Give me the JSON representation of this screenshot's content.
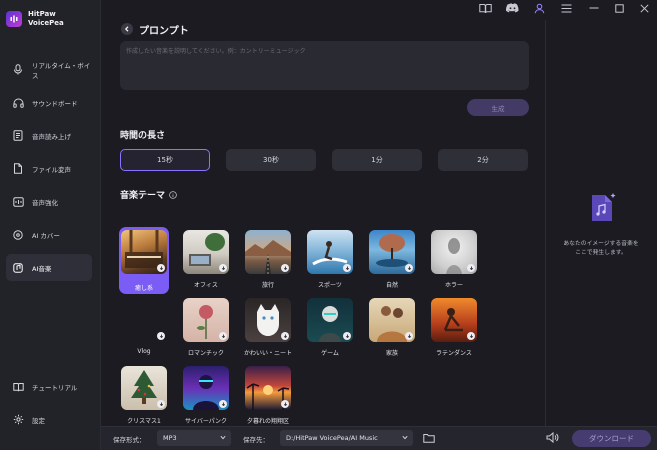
{
  "app": {
    "name_line1": "HitPaw",
    "name_line2": "VoicePea"
  },
  "sidebar": {
    "items": [
      {
        "label": "リアルタイム・ボイス",
        "icon": "microphone-icon"
      },
      {
        "label": "サウンドボード",
        "icon": "headphones-icon"
      },
      {
        "label": "音声読み上げ",
        "icon": "text-to-speech-icon"
      },
      {
        "label": "ファイル変声",
        "icon": "file-icon"
      },
      {
        "label": "音声強化",
        "icon": "enhance-icon"
      },
      {
        "label": "AI カバー",
        "icon": "cover-icon"
      },
      {
        "label": "AI音楽",
        "icon": "music-icon",
        "active": true
      }
    ],
    "bottom": [
      {
        "label": "チュートリアル",
        "icon": "book-icon"
      },
      {
        "label": "設定",
        "icon": "gear-icon"
      }
    ]
  },
  "header": {
    "title": "プロンプト"
  },
  "prompt": {
    "placeholder": "作成したい音楽を説明してください。例：カントリーミュージック",
    "generate_label": "生成"
  },
  "duration": {
    "title": "時間の長さ",
    "options": [
      "15秒",
      "30秒",
      "1分",
      "2分"
    ],
    "selected": "15秒"
  },
  "theme": {
    "title": "音楽テーマ",
    "items": [
      {
        "label": "癒し系",
        "selected": true
      },
      {
        "label": "オフィス"
      },
      {
        "label": "旅行"
      },
      {
        "label": "スポーツ"
      },
      {
        "label": "自然"
      },
      {
        "label": "ホラー"
      },
      {
        "label": "Vlog"
      },
      {
        "label": "ロマンチック"
      },
      {
        "label": "かわいい・ニート"
      },
      {
        "label": "ゲーム"
      },
      {
        "label": "家族"
      },
      {
        "label": "ラテンダンス"
      },
      {
        "label": "クリスマス1"
      },
      {
        "label": "サイバーパンク"
      },
      {
        "label": "夕暮れの翔翔区"
      }
    ]
  },
  "right_panel": {
    "line1": "あなたのイメージする音楽を",
    "line2": "ここで発生します。"
  },
  "bottom": {
    "format_label": "保存形式：",
    "format_value": "MP3",
    "dest_label": "保存先：",
    "dest_value": "D:/HitPaw VoicePea/AI Music",
    "download_label": "ダウンロード"
  },
  "colors": {
    "accent": "#7b5cf5",
    "background": "#1b1b21",
    "sidebar": "#222229"
  }
}
